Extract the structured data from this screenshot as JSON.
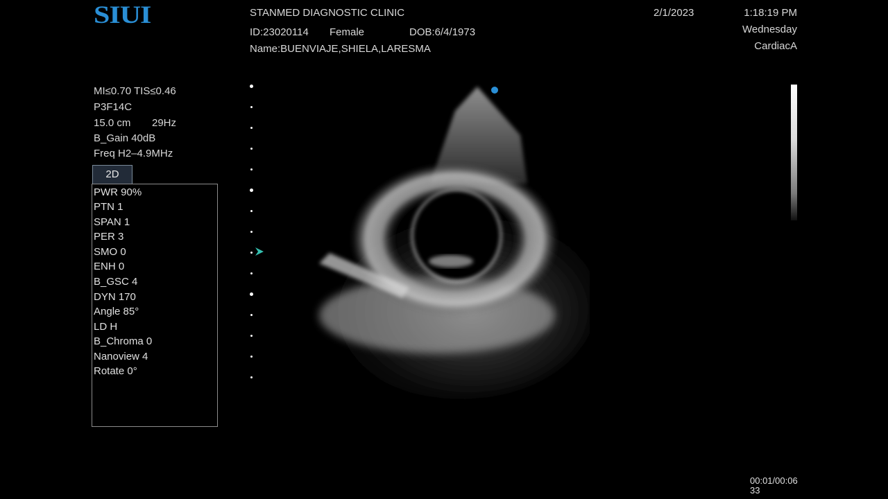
{
  "header": {
    "logo": "SIUI",
    "clinic": "STANMED DIAGNOSTIC CLINIC",
    "patient_id": "ID:23020114",
    "sex": "Female",
    "dob": "DOB:6/4/1973",
    "name": "Name:BUENVIAJE,SHIELA,LARESMA",
    "date": "2/1/2023",
    "time": "1:18:19 PM",
    "weekday": "Wednesday",
    "preset": "CardiacA"
  },
  "params": {
    "mi_tis": "MI≤0.70 TIS≤0.46",
    "probe": "P3F14C",
    "depth": "15.0 cm",
    "frame_rate": "29Hz",
    "gain": "B_Gain 40dB",
    "freq": "Freq H2–4.9MHz"
  },
  "mode_tab": "2D",
  "panel": {
    "items": [
      "PWR 90%",
      "PTN 1",
      "SPAN 1",
      "PER 3",
      "SMO 0",
      "ENH 0",
      "B_GSC 4",
      "DYN 170",
      "Angle 85°",
      "LD H",
      "B_Chroma 0",
      "Nanoview 4",
      "Rotate 0°"
    ]
  },
  "cine": {
    "line1": "00:01/00:06",
    "line2": "33"
  },
  "colors": {
    "logo": "#2a8fd6",
    "orientation_marker": "#2a8fd6",
    "focus_marker": "#35c0b0"
  },
  "icons": {
    "focus_marker": "focus-arrow-icon",
    "orientation_marker": "orientation-dot-icon"
  }
}
